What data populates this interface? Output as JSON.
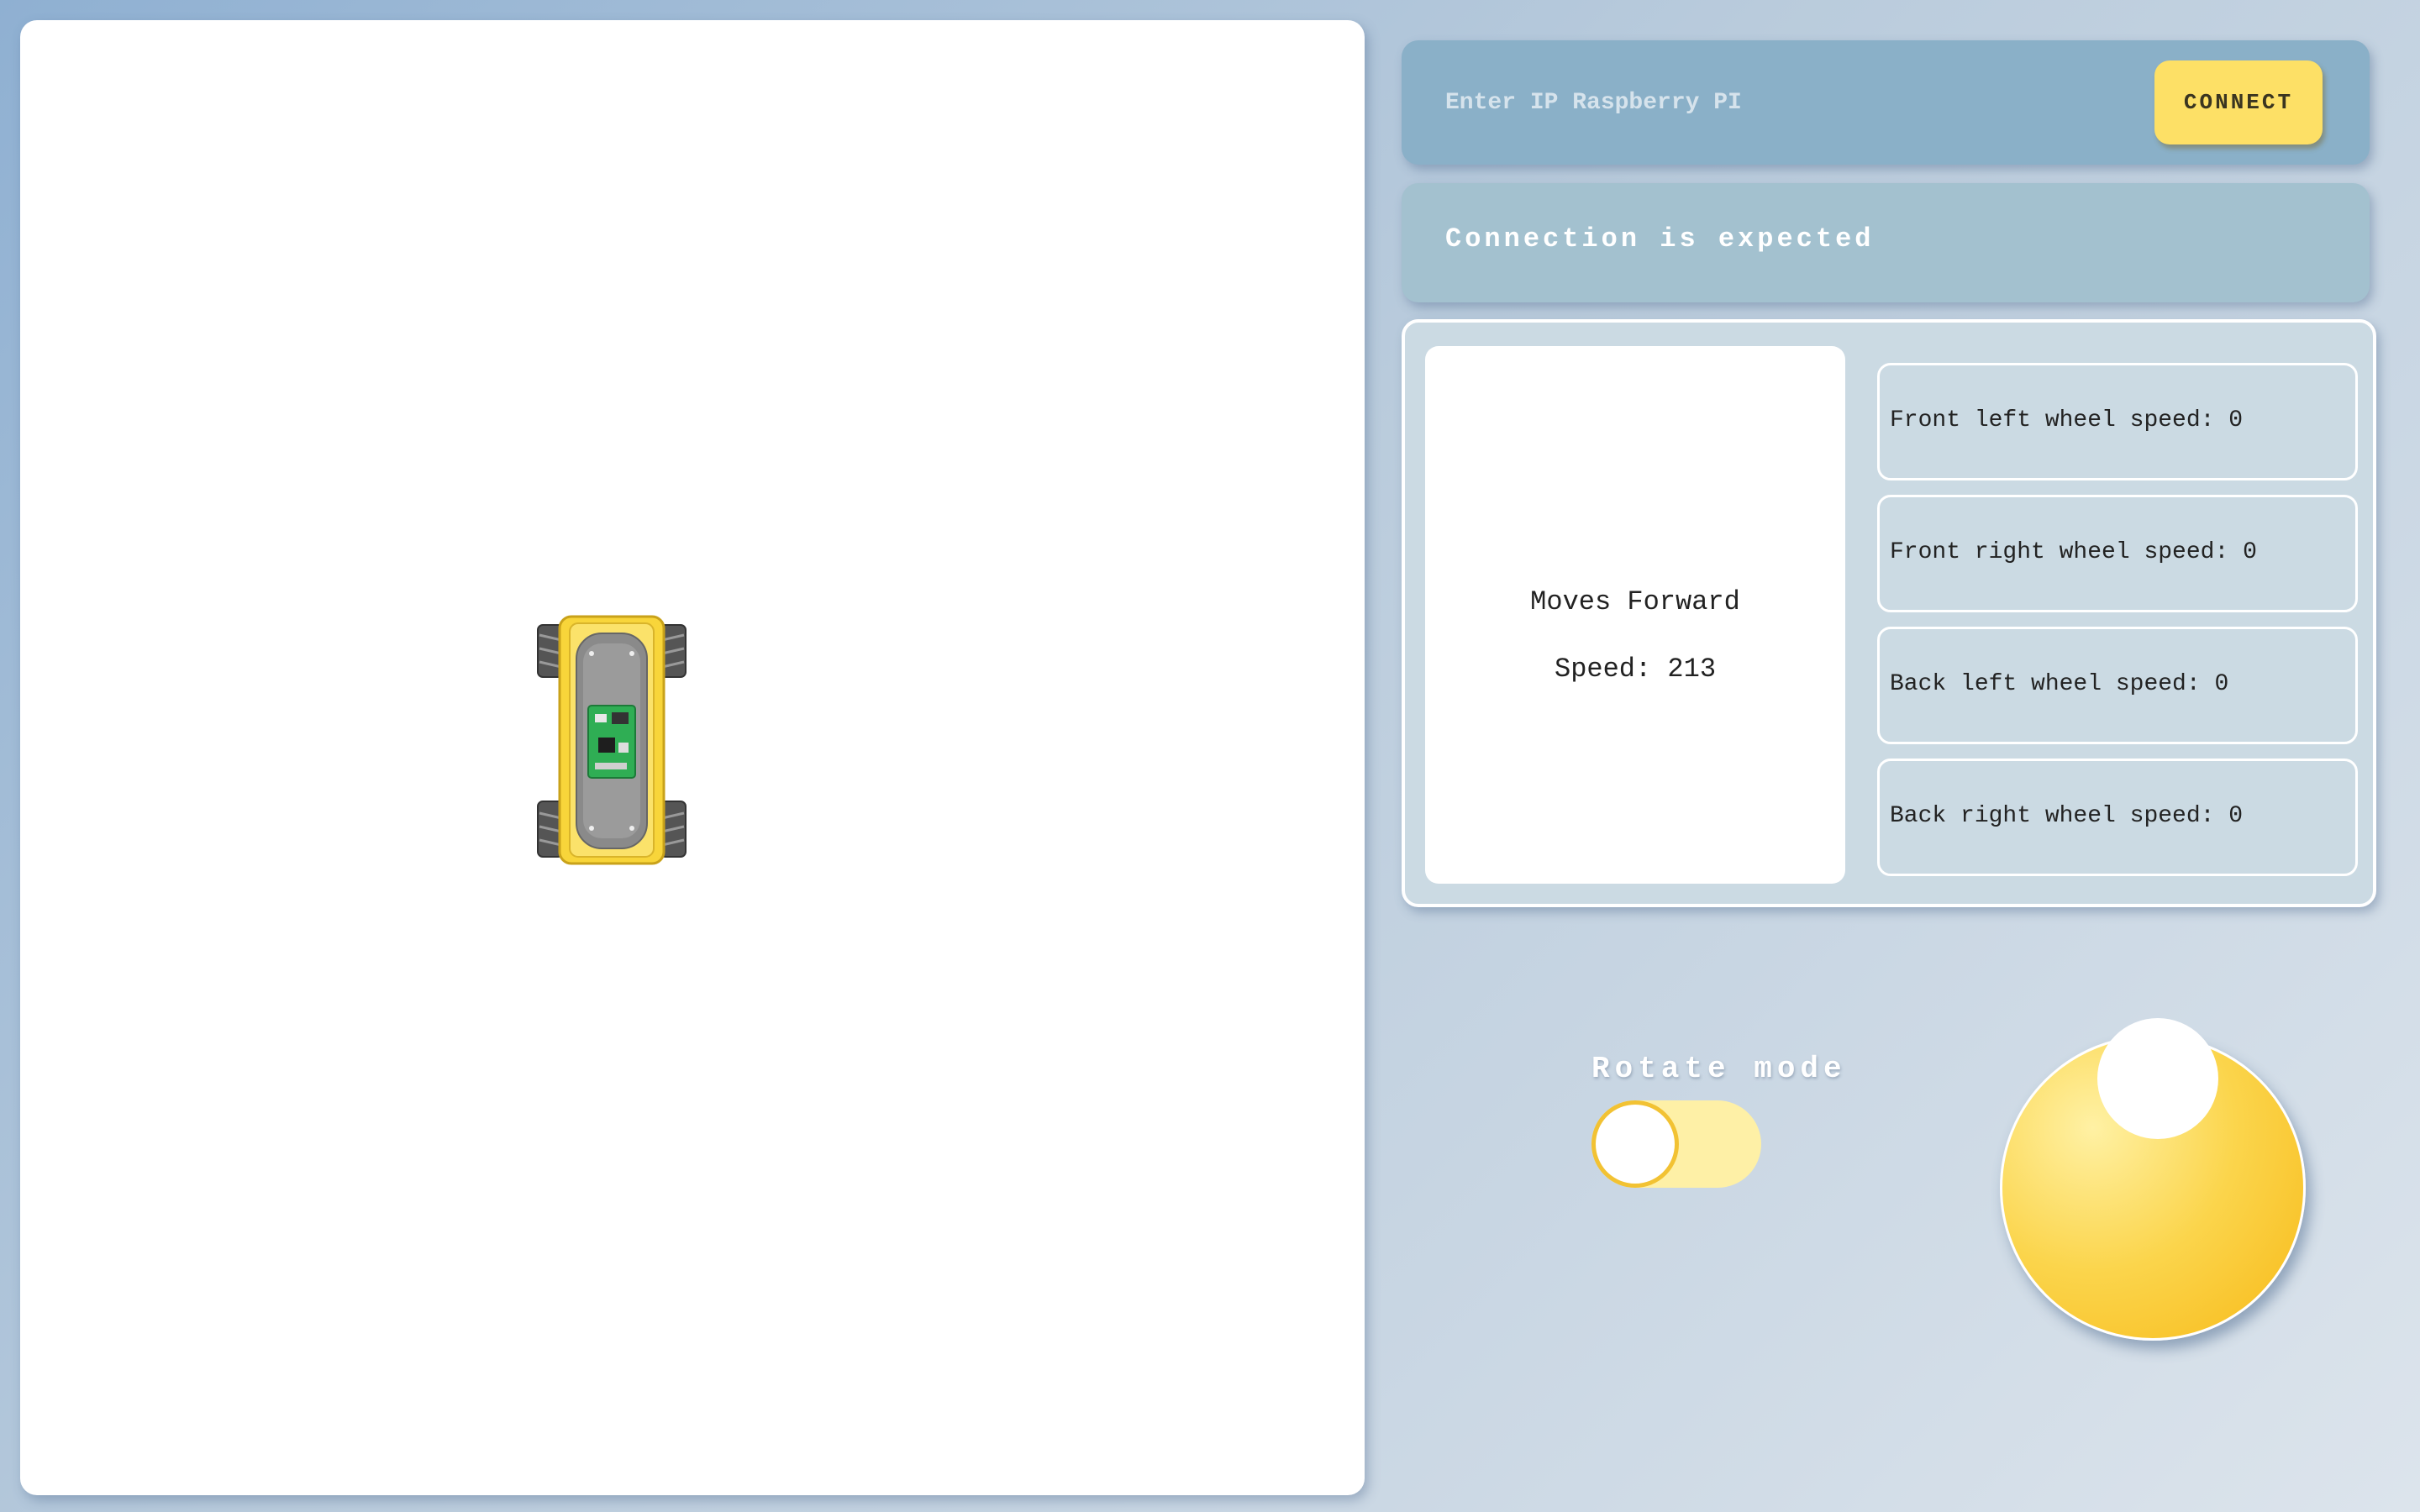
{
  "ip_bar": {
    "placeholder": "Enter IP Raspberry PI",
    "connect_label": "CONNECT"
  },
  "status": {
    "text": "Connection is expected"
  },
  "motion": {
    "direction": "Moves Forward",
    "speed_text": "Speed: 213"
  },
  "wheels": [
    {
      "label": "Front left wheel speed: 0"
    },
    {
      "label": "Front right wheel speed: 0"
    },
    {
      "label": "Back left wheel speed: 0"
    },
    {
      "label": "Back right wheel speed: 0"
    }
  ],
  "rotate_mode": {
    "label": "Rotate mode",
    "enabled": false
  },
  "colors": {
    "accent_yellow": "#fde066",
    "panel_blue": "#8ab0c8",
    "status_blue": "#a3c1cf"
  },
  "icons": {
    "robot": "mecanum-robot-topview-icon"
  }
}
